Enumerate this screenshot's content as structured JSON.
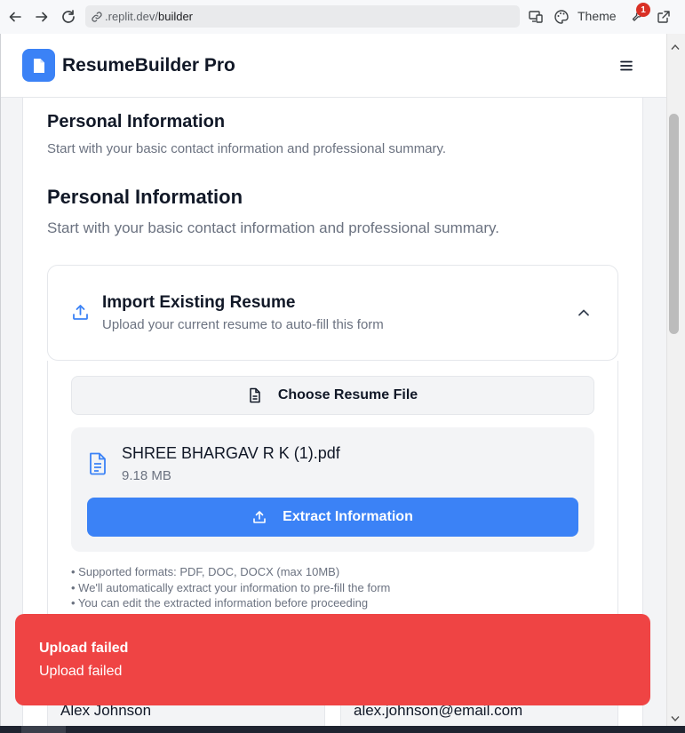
{
  "browser": {
    "url_prefix": ".replit.dev/",
    "url_path": "builder",
    "theme_label": "Theme",
    "notification_count": "1"
  },
  "app": {
    "title": "ResumeBuilder Pro"
  },
  "section": {
    "heading_small": "Personal Information",
    "desc_small": "Start with your basic contact information and professional summary.",
    "heading_large": "Personal Information",
    "desc_large": "Start with your basic contact information and professional summary."
  },
  "import": {
    "title": "Import Existing Resume",
    "subtitle": "Upload your current resume to auto-fill this form",
    "choose_label": "Choose Resume File",
    "file_name": "SHREE BHARGAV R K (1).pdf",
    "file_size": "9.18 MB",
    "extract_label": "Extract Information",
    "notes": [
      "• Supported formats: PDF, DOC, DOCX (max 10MB)",
      "• We'll automatically extract your information to pre-fill the form",
      "• You can edit the extracted information before proceeding"
    ]
  },
  "form": {
    "full_name": "Alex Johnson",
    "email": "alex.johnson@email.com"
  },
  "toast": {
    "title": "Upload failed",
    "message": "Upload failed"
  },
  "colors": {
    "accent": "#3b82f6",
    "error": "#ef4444"
  }
}
